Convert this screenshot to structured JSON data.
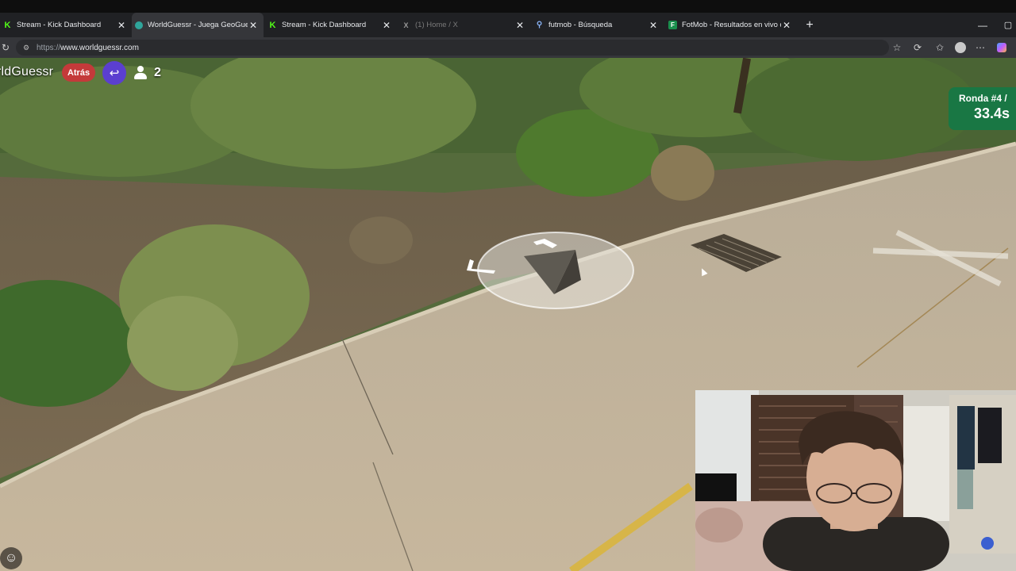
{
  "browser": {
    "tabs": [
      {
        "title": "Stream - Kick Dashboard",
        "favicon": "kick-icon",
        "active": false
      },
      {
        "title": "WorldGuessr - Juega GeoGuessr gratis",
        "favicon": "worldguessr-icon",
        "active": true
      },
      {
        "title": "Stream - Kick Dashboard",
        "favicon": "kick-icon",
        "active": false
      },
      {
        "title": "(1) Home / X",
        "favicon": "x-icon",
        "active": false
      },
      {
        "title": "futmob - Búsqueda",
        "favicon": "search-icon",
        "active": false
      },
      {
        "title": "FotMob - Resultados en vivo de fútbol",
        "favicon": "fotmob-icon",
        "active": false
      }
    ],
    "new_tab_glyph": "+",
    "close_glyph": "✕",
    "url_prefix": "https://",
    "url_host": "www.worldguessr.com"
  },
  "game": {
    "logo_text": "rldGuessr",
    "back_label": "Atrás",
    "player_count": "2",
    "round_label": "Ronda #4 /",
    "round_time": "33.4s"
  },
  "colors": {
    "back_button": "#c43a3a",
    "return_button": "#5b3fd0",
    "round_box": "#167846",
    "kick_green": "#53fc18"
  }
}
